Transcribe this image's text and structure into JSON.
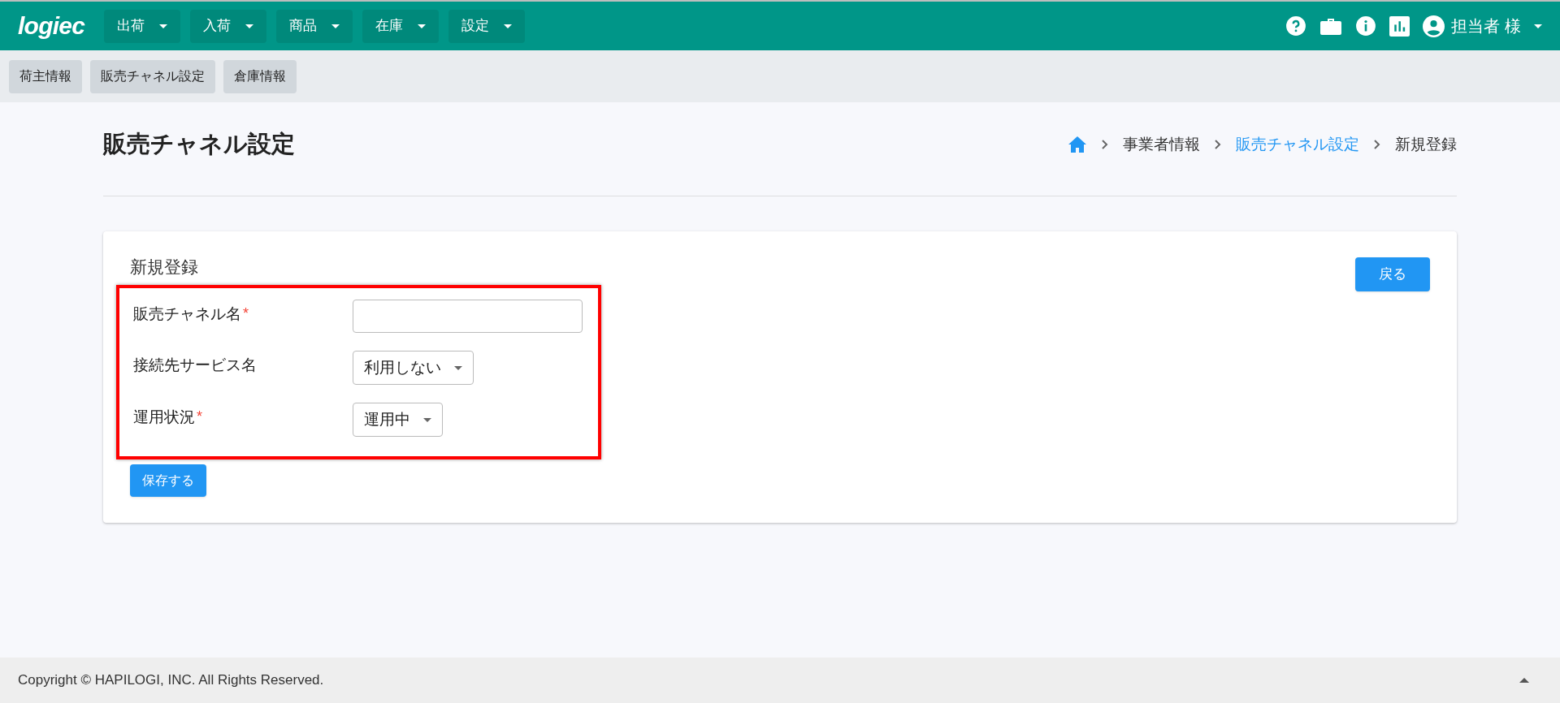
{
  "header": {
    "logo": "logiec",
    "menus": [
      {
        "label": "出荷"
      },
      {
        "label": "入荷"
      },
      {
        "label": "商品"
      },
      {
        "label": "在庫"
      },
      {
        "label": "設定"
      }
    ],
    "user": "担当者 様"
  },
  "subnav": [
    {
      "label": "荷主情報"
    },
    {
      "label": "販売チャネル設定"
    },
    {
      "label": "倉庫情報"
    }
  ],
  "page": {
    "title": "販売チャネル設定",
    "breadcrumb": [
      {
        "label": "事業者情報",
        "link": false
      },
      {
        "label": "販売チャネル設定",
        "link": true
      },
      {
        "label": "新規登録",
        "link": false
      }
    ]
  },
  "card": {
    "title": "新規登録",
    "back_button": "戻る",
    "highlighted": true,
    "fields": [
      {
        "kind": "text",
        "label": "販売チャネル名",
        "required_mark": "*"
      },
      {
        "kind": "select",
        "label": "接続先サービス名",
        "value": "利用しない"
      },
      {
        "kind": "select",
        "label": "運用状況",
        "required_mark": "*",
        "value": "運用中"
      }
    ],
    "save_button": "保存する"
  },
  "footer": {
    "copyright": "Copyright © HAPILOGI, INC. All Rights Reserved."
  }
}
